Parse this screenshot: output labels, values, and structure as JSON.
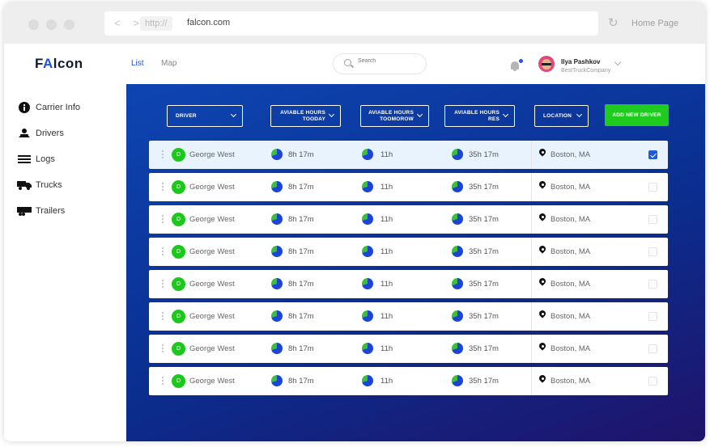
{
  "browser": {
    "nav_arrows": "< >",
    "protocol": "http://",
    "url": "falcon.com",
    "reload_icon": "reload-icon",
    "home_label": "Home Page"
  },
  "app": {
    "logo_prefix": "F",
    "logo_accent": "A",
    "logo_suffix": "lcon",
    "brand_color": "#1e55d6"
  },
  "sidebar": {
    "items": [
      {
        "label": "Carrier Info",
        "icon": "info-icon"
      },
      {
        "label": "Drivers",
        "icon": "driver-icon"
      },
      {
        "label": "Logs",
        "icon": "menu-lines-icon"
      },
      {
        "label": "Trucks",
        "icon": "truck-icon"
      },
      {
        "label": "Trailers",
        "icon": "trailer-icon"
      }
    ]
  },
  "topbar": {
    "tabs": [
      {
        "label": "List",
        "active": true
      },
      {
        "label": "Map",
        "active": false
      }
    ],
    "search_placeholder": "Search",
    "user": {
      "name": "Ilya Pashkov",
      "company": "BestTruckCompany"
    }
  },
  "filters": [
    {
      "label": "DRIVER"
    },
    {
      "label": "AVIABLE HOURS\nTOODAY"
    },
    {
      "label": "AVIABLE HOURS\nTOOMOROW"
    },
    {
      "label": "AVIABLE HOURS\nRES"
    },
    {
      "label": "LOCATION"
    }
  ],
  "add_button": "ADD NEW DRIVER",
  "colors": {
    "accent_green": "#1ecb1e",
    "accent_blue": "#1f59d8",
    "pie_blue": "#1c45d6",
    "pie_green": "#3cc03c"
  },
  "rows": [
    {
      "badge": "D",
      "name": "George West",
      "today": "8h 17m",
      "tomorrow": "11h",
      "res": "35h 17m",
      "location": "Boston, MA",
      "selected": true
    },
    {
      "badge": "D",
      "name": "George West",
      "today": "8h 17m",
      "tomorrow": "11h",
      "res": "35h 17m",
      "location": "Boston, MA",
      "selected": false
    },
    {
      "badge": "D",
      "name": "George West",
      "today": "8h 17m",
      "tomorrow": "11h",
      "res": "35h 17m",
      "location": "Boston, MA",
      "selected": false
    },
    {
      "badge": "D",
      "name": "George West",
      "today": "8h 17m",
      "tomorrow": "11h",
      "res": "35h 17m",
      "location": "Boston, MA",
      "selected": false
    },
    {
      "badge": "D",
      "name": "George West",
      "today": "8h 17m",
      "tomorrow": "11h",
      "res": "35h 17m",
      "location": "Boston, MA",
      "selected": false
    },
    {
      "badge": "D",
      "name": "George West",
      "today": "8h 17m",
      "tomorrow": "11h",
      "res": "35h 17m",
      "location": "Boston, MA",
      "selected": false
    },
    {
      "badge": "D",
      "name": "George West",
      "today": "8h 17m",
      "tomorrow": "11h",
      "res": "35h 17m",
      "location": "Boston, MA",
      "selected": false
    },
    {
      "badge": "D",
      "name": "George West",
      "today": "8h 17m",
      "tomorrow": "11h",
      "res": "35h 17m",
      "location": "Boston, MA",
      "selected": false
    }
  ]
}
